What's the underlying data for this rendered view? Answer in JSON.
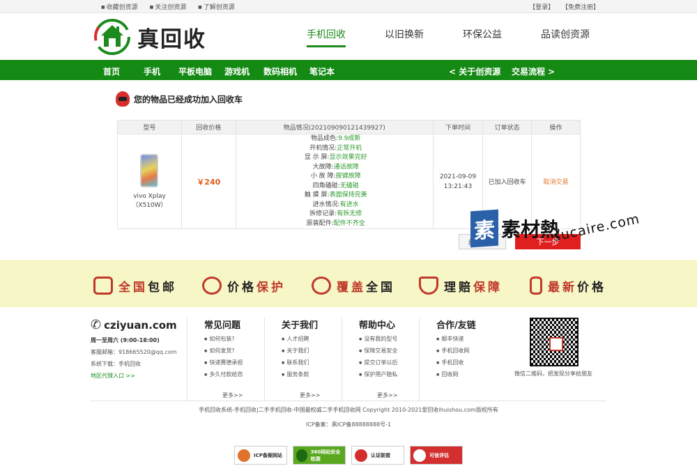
{
  "topbar": {
    "links": [
      "收藏创资源",
      "关注创资源",
      "了解创资源"
    ],
    "login": "【登录】",
    "register": "【免费注册】"
  },
  "header": {
    "logo_text": "真回收",
    "nav": [
      "手机回收",
      "以旧换新",
      "环保公益",
      "品读创资源"
    ],
    "active_index": 0
  },
  "greennav": {
    "categories": [
      "首页",
      "手机",
      "平板电脑",
      "游戏机",
      "数码相机",
      "笔记本"
    ],
    "right_links": [
      "< 关于创资源",
      "交易流程 >"
    ]
  },
  "cart": {
    "title": "您的物品已经成功加入回收车",
    "headers": [
      "型号",
      "回收价格",
      "物品情况(202109090121439927)",
      "下单时间",
      "订单状态",
      "操作"
    ],
    "row": {
      "model": "vivo Xplay（X510W）",
      "price": "￥240",
      "conditions": [
        {
          "label": "物品成色:",
          "value": "9.9成新"
        },
        {
          "label": "开机情况:",
          "value": "正常开机"
        },
        {
          "label": "显 示 屏:",
          "value": "显示效果完好"
        },
        {
          "label": "大故障:",
          "value": "通话故障"
        },
        {
          "label": "小 故 障:",
          "value": "按键故障"
        },
        {
          "label": "四角磕碰:",
          "value": "无磕碰"
        },
        {
          "label": "触 摸 屏:",
          "value": "表面保持完美"
        },
        {
          "label": "进水情况:",
          "value": "有进水"
        },
        {
          "label": "拆修记录:",
          "value": "有拆无修"
        },
        {
          "label": "原装配件:",
          "value": "配件不齐全"
        }
      ],
      "date": "2021-09-09",
      "time": "13:21:43",
      "status": "已加入回收车",
      "action": "取消交易"
    },
    "continue_label": "继续回收",
    "next_label": "下一步"
  },
  "watermark": {
    "cn": "素材熱",
    "en": "sucaire.com",
    "box": "素"
  },
  "benefits": [
    {
      "a": "全国",
      "b": "包邮"
    },
    {
      "a": "价格",
      "b": "保护"
    },
    {
      "a": "覆盖",
      "b": "全国"
    },
    {
      "a": "理赔",
      "b": "保障"
    },
    {
      "a": "最新",
      "b": "价格"
    }
  ],
  "footer": {
    "site": "cziyuan.com",
    "hours": "周一至周六 (9:00-18:00)",
    "email": "客服邮箱：918665520@qq.com",
    "download": "系统下载：手机回收",
    "agent": "地区代理入口 >>",
    "columns": [
      {
        "title": "常见问题",
        "items": [
          "如何包装?",
          "如何发货?",
          "快递赛德承担",
          "多久付款给您"
        ],
        "more": "更多>>"
      },
      {
        "title": "关于我们",
        "items": [
          "人才招聘",
          "关于我们",
          "联系我们",
          "服务条款"
        ],
        "more": "更多>>"
      },
      {
        "title": "帮助中心",
        "items": [
          "没有我的型号",
          "保障交易安全",
          "提交订单以后",
          "保护用户隐私"
        ],
        "more": "更多>>"
      },
      {
        "title": "合作/友链",
        "items": [
          "顺丰快递",
          "手机回收网",
          "手机回收",
          "回收网"
        ],
        "more": ""
      }
    ],
    "qr_caption": "微信二维码，把发现分享给朋友",
    "copyright": "手机回收系统-手机回收|二手手机回收-中国最权威二手手机回收网 Copyright 2010-2021爱回收ihuishou.com版权所有",
    "icp": "ICP备案：黑ICP备88888888号-1",
    "certs": [
      "ICP备案网站",
      "360网站安全检测",
      "认证联盟",
      "可信评估"
    ]
  }
}
